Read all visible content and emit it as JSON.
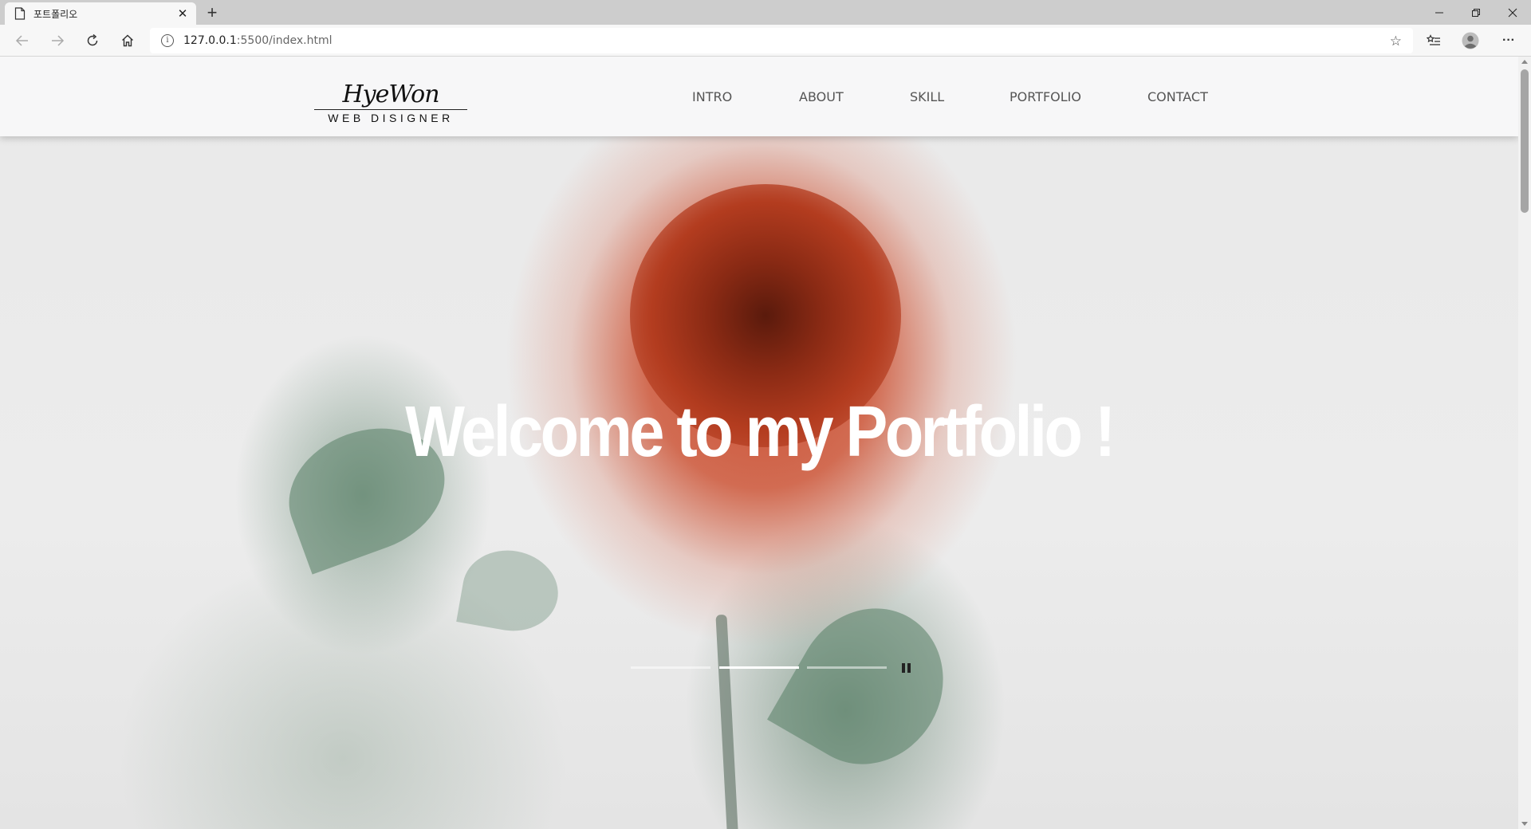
{
  "browser": {
    "tab_title": "포트폴리오",
    "tab_close": "✕",
    "new_tab": "+",
    "url_host": "127.0.0.1",
    "url_rest": ":5500/index.html",
    "icons": [
      "document-icon",
      "back-icon",
      "forward-icon",
      "refresh-icon",
      "home-icon",
      "info-icon",
      "star-icon",
      "favorites-icon",
      "profile-icon",
      "more-icon",
      "minimize-icon",
      "restore-icon",
      "close-icon"
    ],
    "more_label": "···",
    "star_label": "☆"
  },
  "site": {
    "logo_script": "HyeWon",
    "logo_sub": "WEB DISIGNER",
    "nav": [
      "INTRO",
      "ABOUT",
      "SKILL",
      "PORTFOLIO",
      "CONTACT"
    ],
    "headline": "Welcome to my Portfolio !",
    "slider": {
      "slides": 3,
      "active_index": 1
    }
  },
  "colors": {
    "header_bg": "#f7f7f8",
    "nav_text": "#555555",
    "headline": "#ffffff",
    "accent_rose": "#c8462a"
  }
}
